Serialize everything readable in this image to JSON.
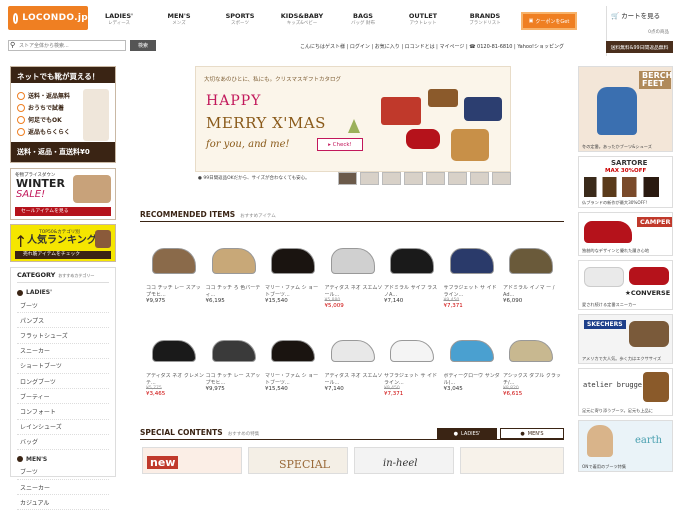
{
  "header": {
    "logo": "LOCONDO.jp",
    "nav": [
      {
        "label": "LADIES'",
        "sub": "レディース"
      },
      {
        "label": "MEN'S",
        "sub": "メンズ"
      },
      {
        "label": "SPORTS",
        "sub": "スポーツ"
      },
      {
        "label": "KIDS&BABY",
        "sub": "キッズ&ベビー"
      },
      {
        "label": "BAGS",
        "sub": "バッグ 財布"
      },
      {
        "label": "OUTLET",
        "sub": "アウトレット"
      },
      {
        "label": "BRANDS",
        "sub": "ブランドリスト"
      }
    ],
    "coupon_label": "クーポンをGet",
    "cart_label": "カートを見る",
    "cart_sub": "0点の商品",
    "search_placeholder": "ストア全体から検索...",
    "search_button": "検索",
    "top_links": "こんにちはゲスト様 | ログイン | お気に入り | ロコンドとは | マイページ | ☎ 0120-81-6810 | Yahoo!ショッピング",
    "free_ship": "送料無料&99日間返品無料"
  },
  "sidebar": {
    "campaign_title": "ネットでも靴が買える！",
    "campaign_items": [
      "送料・返品無料",
      "おうちで試着",
      "何足でもOK",
      "返品もらくらく"
    ],
    "campaign_footer": "送料・返品・直送料¥0",
    "winter_pre": "冬物プライスダウン",
    "winter_title": "WINTER",
    "winter_sale": "SALE!",
    "winter_button": "セールアイテムを見る",
    "ranking_pre": "TOP50&カテゴリ別",
    "ranking_title": "人気ランキング",
    "ranking_button": "売れ筋アイテムをチェック",
    "category_title": "CATEGORY",
    "category_sub": "おすすめカテゴリー",
    "ladies_label": "LADIES'",
    "ladies_items": [
      "ブーツ",
      "パンプス",
      "フラットシューズ",
      "スニーカー",
      "ショートブーツ",
      "ロングブーツ",
      "ブーティー",
      "コンフォート",
      "レインシューズ",
      "バッグ"
    ],
    "mens_label": "MEN'S",
    "mens_items": [
      "ブーツ",
      "スニーカー",
      "カジュアル"
    ]
  },
  "banner": {
    "line1": "大切なあのひとに、私にも。クリスマスギフトカタログ",
    "line2": "HAPPY",
    "line3": "MERRY X'MAS",
    "line4": "for you, and me!",
    "check": "▸ Check!",
    "note": "99日間返品OKだから、サイズが合わなくても安心。"
  },
  "recommended": {
    "title": "RECOMMENDED ITEMS",
    "sub": "おすすめアイテム",
    "row1": [
      {
        "name": "ココ チッチ レー スアップモヒ...",
        "price": "¥9,975",
        "old": "",
        "sale": ""
      },
      {
        "name": "ココ チッチ ろ 色パーティ...",
        "price": "¥6,195",
        "old": "",
        "sale": ""
      },
      {
        "name": "マリー・ファム シ ョートブーツ...",
        "price": "¥15,540",
        "old": "",
        "sale": ""
      },
      {
        "name": "アディダス ネオ スエムソール...",
        "price": "",
        "old": "¥5,880",
        "sale": "¥5,009"
      },
      {
        "name": "アドミラル サイブ ラスノA...",
        "price": "¥7,140",
        "old": "",
        "sale": ""
      },
      {
        "name": "サフラジェット サ イドライン...",
        "price": "",
        "old": "¥9,450",
        "sale": "¥7,371"
      },
      {
        "name": "アドミラル イノマ ー / Ad...",
        "price": "¥6,090",
        "old": "",
        "sale": ""
      }
    ],
    "row2": [
      {
        "name": "アディダス ネオ クレメンテ...",
        "price": "",
        "old": "¥5,775",
        "sale": "¥3,465"
      },
      {
        "name": "ココ チッチ レー スアップモヒ...",
        "price": "¥9,975",
        "old": "",
        "sale": ""
      },
      {
        "name": "マリー・ファム シ ョートブーツ...",
        "price": "¥15,540",
        "old": "",
        "sale": ""
      },
      {
        "name": "アディダス ネオ スエムソール...",
        "price": "¥7,140",
        "old": "",
        "sale": ""
      },
      {
        "name": "サフラジェット サ イドライン...",
        "price": "",
        "old": "¥9,450",
        "sale": "¥7,371"
      },
      {
        "name": "ボディーグローヴ サンダル(...",
        "price": "¥3,045",
        "old": "",
        "sale": ""
      },
      {
        "name": "アシックス ダブル クラッチ/...",
        "price": "",
        "old": "¥8,820",
        "sale": "¥6,615"
      }
    ]
  },
  "special": {
    "title": "SPECIAL CONTENTS",
    "sub": "おすすめの特集",
    "tab_ladies": "LADIES'",
    "tab_mens": "MEN'S",
    "promo1": "new",
    "promo2": "SPECIAL",
    "promo3": "in-heel"
  },
  "right": [
    {
      "title": "BERCH FEET",
      "caption": "冬の定番。あったかブーツ&シューズ"
    },
    {
      "title": "SARTORE",
      "badge": "MAX 30%OFF",
      "caption": "仏ブランドの新作が最大30%OFF!"
    },
    {
      "title": "CAMPER",
      "caption": "独創的なデザインと優れた履き心地"
    },
    {
      "title": "★CONVERSE",
      "caption": "愛され続ける定番スニーカー"
    },
    {
      "title": "SKECHERS",
      "caption": "アメリカで大人気。歩く力はエクササイズ"
    },
    {
      "title": "atelier brugge",
      "caption": "足元に寄り添うブーツ。足元も上品に"
    },
    {
      "title": "earth",
      "caption": "ONで着用のブーツ特集"
    }
  ],
  "colors": {
    "brand": "#ef7f22",
    "dark": "#3a2414",
    "sale": "#cc0000"
  }
}
